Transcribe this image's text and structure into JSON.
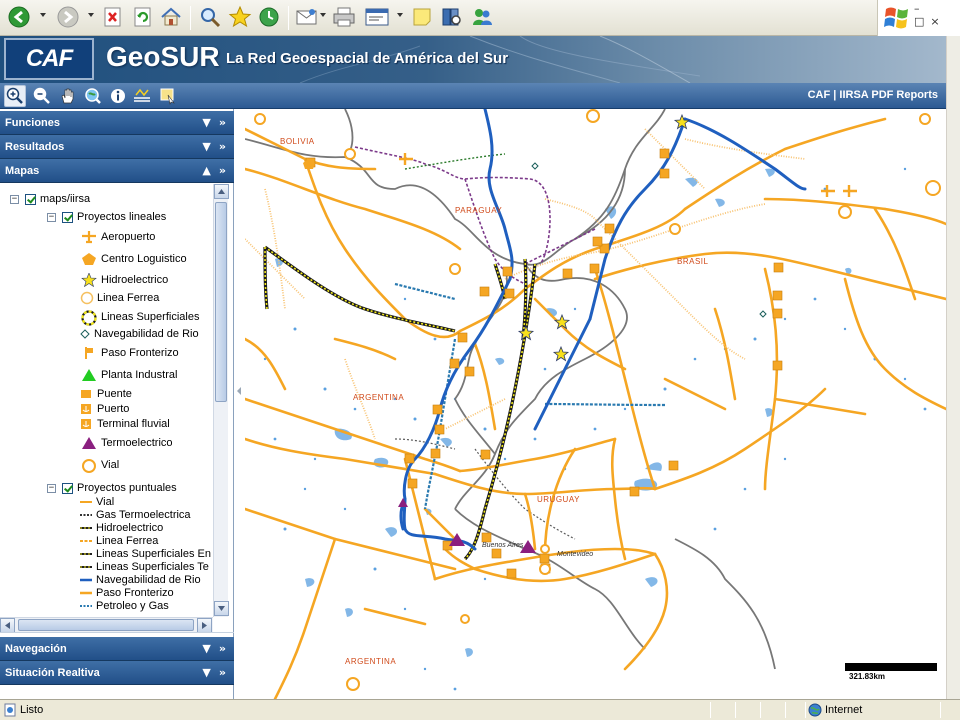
{
  "banner": {
    "caf_logo": "CAF",
    "geosur_logo": "GeoSUR",
    "tagline": "La Red Geoespacial de América del Sur"
  },
  "map_toolbar": {
    "tools": [
      "zoom-in-icon",
      "zoom-out-icon",
      "pan-hand-icon",
      "zoom-extent-icon",
      "info-icon",
      "measure-icon",
      "select-icon"
    ],
    "reports_link": "CAF | IIRSA PDF Reports"
  },
  "panels": {
    "funciones": "Funciones",
    "resultados": "Resultados",
    "mapas": "Mapas",
    "navegacion": "Navegación",
    "situacion": "Situación Realtiva"
  },
  "tree": {
    "root": "maps/iirsa",
    "group_lineales": "Proyectos lineales",
    "lineales_items": [
      "Aeropuerto",
      "Centro Loguistico",
      "Hidroelectrico",
      "Linea Ferrea",
      "Lineas Superficiales",
      "Navegabilidad de Rio",
      "Paso Fronterizo",
      "Planta Industral",
      "Puente",
      "Puerto",
      "Terminal fluvial",
      "Termoelectrico",
      "Vial"
    ],
    "group_puntuales": "Proyectos puntuales",
    "puntuales_items": [
      "Vial",
      "Gas Termoelectrica",
      "Hidroelectrico",
      "Linea Ferrea",
      "Lineas Superficiales En",
      "Lineas Superficiales Te",
      "Navegabilidad de Rio",
      "Paso Fronterizo",
      "Petroleo y Gas"
    ]
  },
  "map": {
    "country_labels": [
      "BOLIVIA",
      "PARAGUAY",
      "BRASIL",
      "ARGENTINA",
      "URUGUAY",
      "ARGENTINA"
    ],
    "city_labels": [
      "Buenos Aires",
      "Montevideo"
    ],
    "scale": "321.83km"
  },
  "status": {
    "text": "Listo",
    "zone": "Internet"
  },
  "colors": {
    "road": "#f5a623",
    "river": "#1f5fbf",
    "border": "#777777",
    "water": "#5aa0e0",
    "header": "#2b5b95"
  }
}
